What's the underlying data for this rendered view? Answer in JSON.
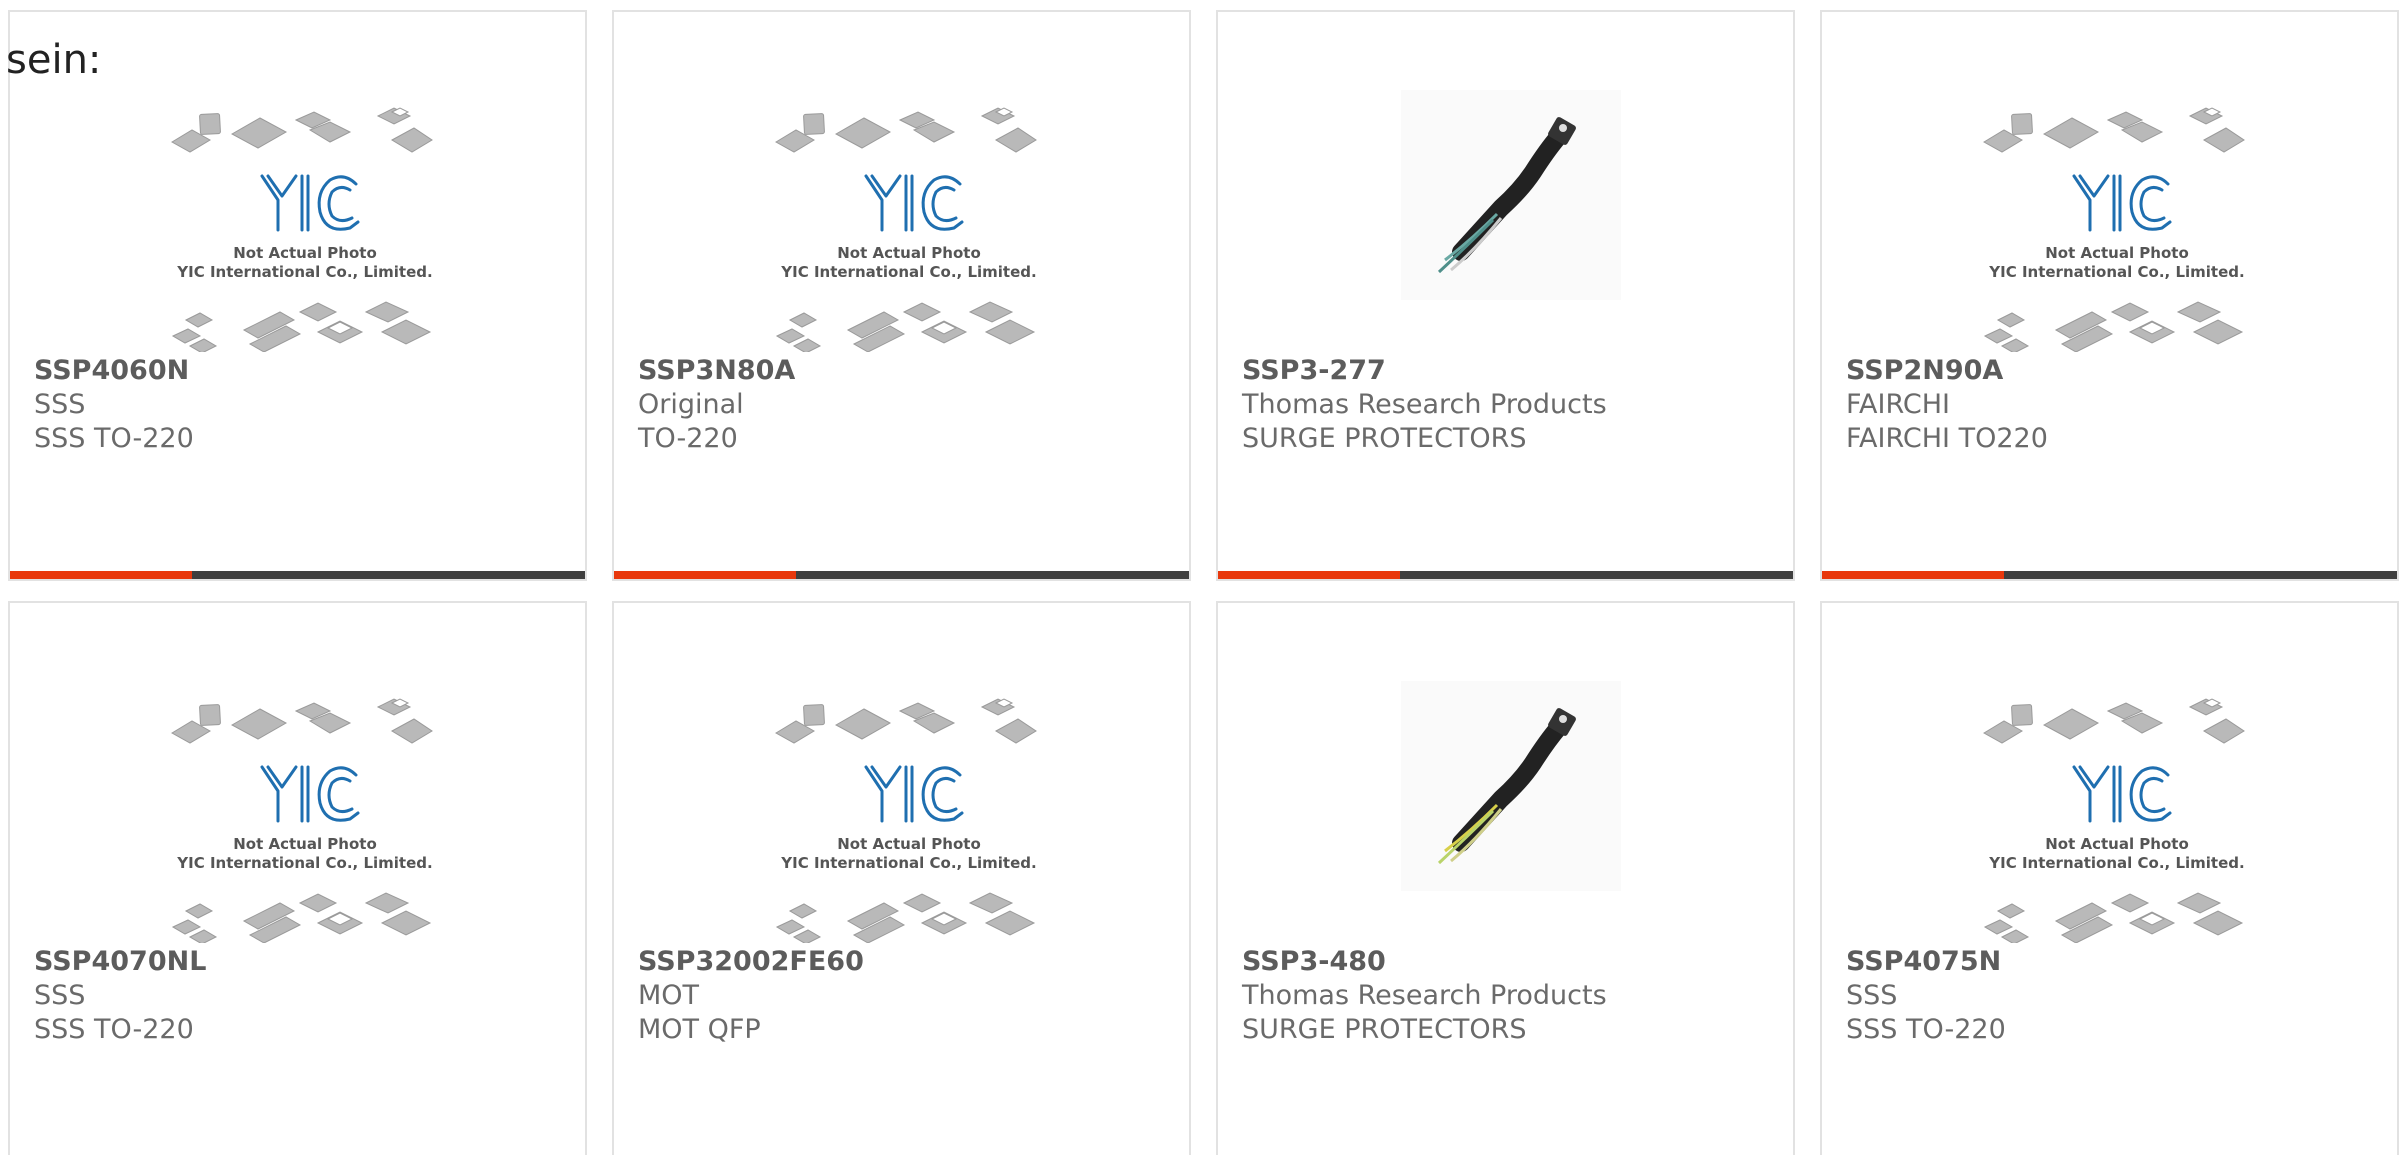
{
  "intro_text": "sein:",
  "colors": {
    "accent": "#e8380d",
    "bar": "#3f3f3f",
    "yic_blue": "#1f6fb0"
  },
  "placeholder": {
    "line1": "Not Actual Photo",
    "line2": "YIC International Co., Limited."
  },
  "products": [
    {
      "part": "SSP4060N",
      "maker": "SSS",
      "desc": "SSS TO-220",
      "image": "placeholder"
    },
    {
      "part": "SSP3N80A",
      "maker": "Original",
      "desc": "TO-220",
      "image": "placeholder"
    },
    {
      "part": "SSP3-277",
      "maker": "Thomas Research Products",
      "desc": "SURGE PROTECTORS",
      "image": "surge-protector-photo"
    },
    {
      "part": "SSP2N90A",
      "maker": "FAIRCHI",
      "desc": "FAIRCHI TO220",
      "image": "placeholder"
    },
    {
      "part": "SSP4070NL",
      "maker": "SSS",
      "desc": "SSS TO-220",
      "image": "placeholder"
    },
    {
      "part": "SSP32002FE60",
      "maker": "MOT",
      "desc": "MOT QFP",
      "image": "placeholder"
    },
    {
      "part": "SSP3-480",
      "maker": "Thomas Research Products",
      "desc": "SURGE PROTECTORS",
      "image": "surge-protector-photo"
    },
    {
      "part": "SSP4075N",
      "maker": "SSS",
      "desc": "SSS TO-220",
      "image": "placeholder"
    }
  ]
}
